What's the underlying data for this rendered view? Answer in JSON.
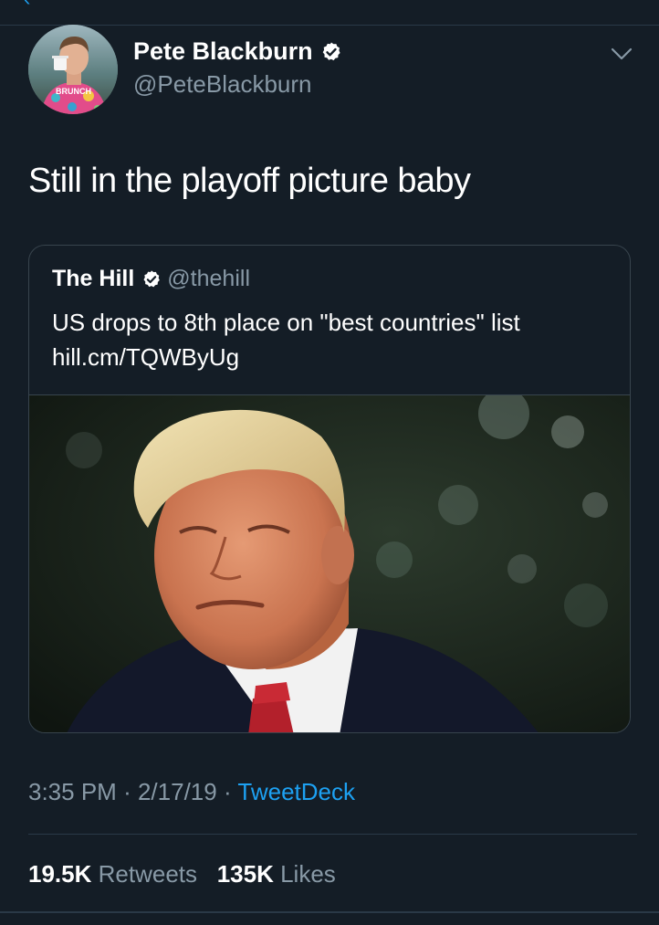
{
  "tweet": {
    "author": {
      "display_name": "Pete Blackburn",
      "handle": "@PeteBlackburn",
      "verified": true,
      "avatar_shirt_text": "BRUNCH"
    },
    "text": "Still in the playoff picture baby",
    "quoted": {
      "display_name": "The Hill",
      "handle": "@thehill",
      "verified": true,
      "text": "US drops to 8th place on \"best countries\" list",
      "link": "hill.cm/TQWByUg"
    },
    "time": "3:35 PM",
    "separator": "·",
    "date": "2/17/19",
    "source": "TweetDeck",
    "retweets_count": "19.5K",
    "retweets_label": "Retweets",
    "likes_count": "135K",
    "likes_label": "Likes"
  },
  "colors": {
    "background": "#141d26",
    "accent": "#1da1f2",
    "secondary_text": "#8899a6",
    "border": "#38444d"
  },
  "icons": {
    "back": "back-arrow-icon",
    "verified": "verified-badge-icon",
    "more": "chevron-down-icon"
  }
}
